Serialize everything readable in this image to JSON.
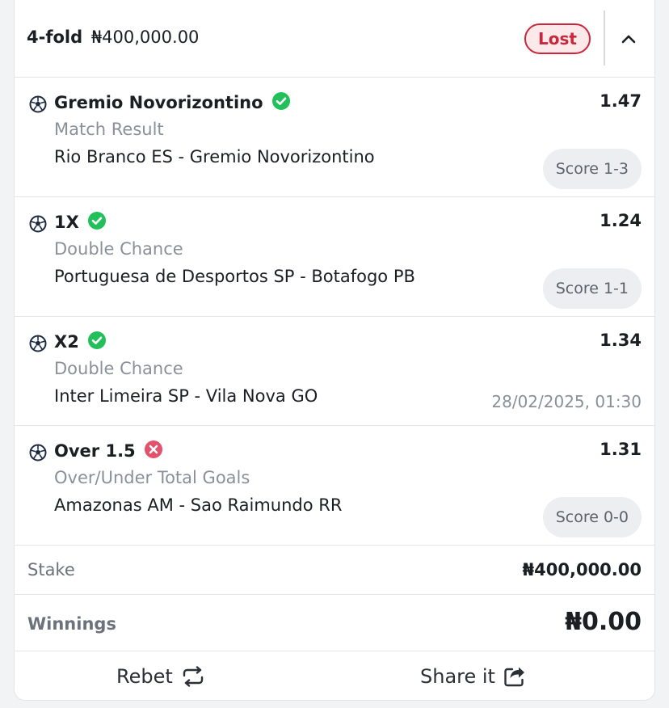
{
  "header": {
    "fold_label": "4-fold",
    "stake_amount": "₦400,000.00",
    "status": "Lost",
    "collapse_icon": "chevron-up-icon"
  },
  "selections": [
    {
      "name": "Gremio Novorizontino",
      "result": "won",
      "odds": "1.47",
      "market": "Match Result",
      "match": "Rio Branco ES - Gremio Novorizontino",
      "score": "Score 1-3"
    },
    {
      "name": "1X",
      "result": "won",
      "odds": "1.24",
      "market": "Double Chance",
      "match": "Portuguesa de Desportos SP - Botafogo PB",
      "score": "Score 1-1"
    },
    {
      "name": "X2",
      "result": "won",
      "odds": "1.34",
      "market": "Double Chance",
      "match": "Inter Limeira SP - Vila Nova GO",
      "date": "28/02/2025, 01:30"
    },
    {
      "name": "Over 1.5",
      "result": "lost",
      "odds": "1.31",
      "market": "Over/Under Total Goals",
      "match": "Amazonas AM - Sao Raimundo RR",
      "score": "Score 0-0"
    }
  ],
  "summary": {
    "stake_label": "Stake",
    "stake_value": "₦400,000.00",
    "winnings_label": "Winnings",
    "winnings_value": "₦0.00"
  },
  "actions": {
    "rebet_label": "Rebet",
    "share_label": "Share it"
  },
  "colors": {
    "lost_red": "#c8283b",
    "won_green": "#22c05a",
    "lost_icon": "#e5506a"
  }
}
